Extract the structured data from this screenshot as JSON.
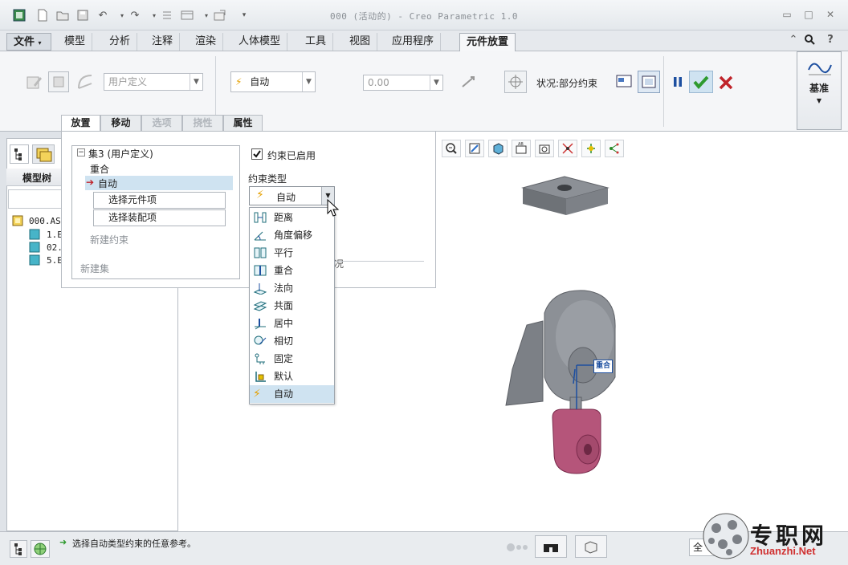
{
  "window": {
    "title": "000 (活动的) - Creo Parametric 1.0"
  },
  "menu": {
    "file": "文件",
    "tabs": [
      "模型",
      "分析",
      "注释",
      "渲染",
      "人体模型",
      "工具",
      "视图",
      "应用程序"
    ],
    "active_tab": "元件放置"
  },
  "ribbon": {
    "constraint_set_combo": "用户定义",
    "constraint_type_combo": "自动",
    "offset_combo": "0.00",
    "status_label": "状况:部分约束",
    "datum_label": "基准"
  },
  "subtabs": [
    "放置",
    "移动",
    "选项",
    "挠性",
    "属性"
  ],
  "placement": {
    "set_label": "集3 (用户定义)",
    "constraint_coincident": "重合",
    "constraint_auto": "自动",
    "select_component_item": "选择元件项",
    "select_assembly_item": "选择装配项",
    "new_constraint": "新建约束",
    "new_set": "新建集",
    "constraint_enabled_label": "约束已启用",
    "constraint_enabled_checked": true,
    "constraint_type_label": "约束类型",
    "constraint_type_value": "自动",
    "hidden_trailing_char": "况"
  },
  "dropdown_options": [
    {
      "label": "距离",
      "icon": "distance-icon"
    },
    {
      "label": "角度偏移",
      "icon": "angle-offset-icon"
    },
    {
      "label": "平行",
      "icon": "parallel-icon"
    },
    {
      "label": "重合",
      "icon": "coincident-icon"
    },
    {
      "label": "法向",
      "icon": "normal-icon"
    },
    {
      "label": "共面",
      "icon": "coplanar-icon"
    },
    {
      "label": "居中",
      "icon": "centered-icon"
    },
    {
      "label": "相切",
      "icon": "tangent-icon"
    },
    {
      "label": "固定",
      "icon": "fix-icon"
    },
    {
      "label": "默认",
      "icon": "default-icon"
    },
    {
      "label": "自动",
      "icon": "auto-icon"
    }
  ],
  "model_tree": {
    "header": "模型树",
    "root": "000.AS",
    "items": [
      "1.E",
      "02.",
      "5.E"
    ]
  },
  "viewport": {
    "tag_label": "重合"
  },
  "status": {
    "message": "选择自动类型约束的任意参考。",
    "filter_value": "全"
  },
  "watermark": {
    "cn": "专职网",
    "en": "Zhuanzhi.Net"
  },
  "colors": {
    "accept": "#2e9a2e",
    "cancel": "#c0232a",
    "pause": "#1d4fa0",
    "selection": "#cfe3f1",
    "part_gray": "#8c9096",
    "part_pink": "#b5557a"
  }
}
